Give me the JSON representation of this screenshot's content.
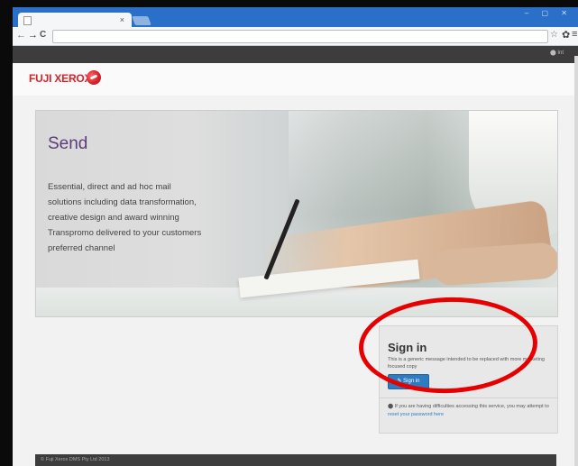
{
  "browser": {
    "tab_title": "",
    "tab_close": "×",
    "nav_back": "←",
    "nav_forward": "→",
    "nav_reload": "C",
    "address": "",
    "star_icon": "☆",
    "gear_icon": "✿",
    "menu_icon": "≡",
    "window_controls": "– ▢ ✕"
  },
  "topbar": {
    "login_text": "⬤ Int"
  },
  "brand": {
    "logo_text": "FUJI XEROX",
    "accent": "#d8232a"
  },
  "hero": {
    "title": "Send",
    "lines": [
      "Essential, direct and ad hoc mail",
      "solutions including data transformation,",
      "creative design and award winning",
      "Transpromo delivered to your customers",
      "preferred channel"
    ]
  },
  "signin": {
    "title": "Sign in",
    "message": "This is a generic message intended to be replaced with more marketing focused copy",
    "button_label": "✎ Sign in",
    "help_prefix": "⬤ If you are having difficulties accessing this service, you may attempt to ",
    "help_link": "reset your password here"
  },
  "footer": {
    "copyright": "© Fuji Xerox DMS Pty Ltd 2013"
  },
  "colors": {
    "button": "#2f7bbf",
    "title_purple": "#5a3d7a",
    "annotation": "#e60000"
  }
}
